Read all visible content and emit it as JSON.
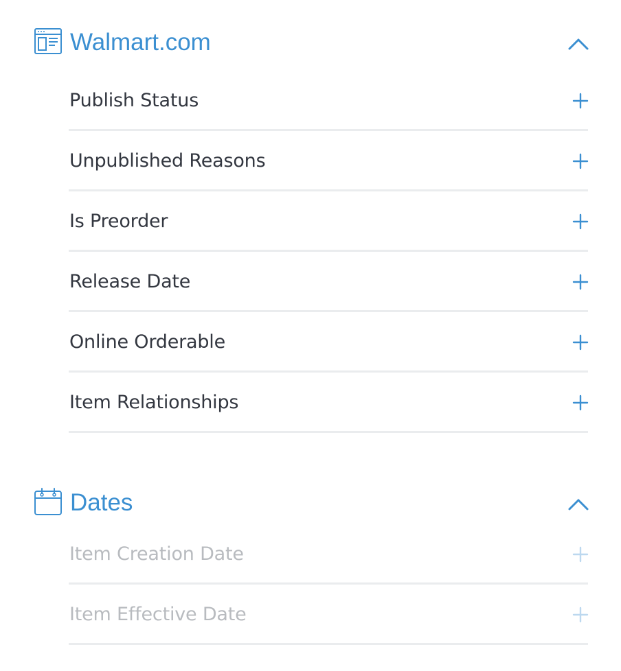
{
  "colors": {
    "accent": "#3b8fd1",
    "text": "#333740",
    "disabled_text": "#b8bbbf",
    "disabled_accent": "#bcd8ef",
    "divider": "#eaecee"
  },
  "sections": [
    {
      "title": "Walmart.com",
      "icon": "browser-window-icon",
      "toggle_icon": "chevron-up-icon",
      "items": [
        {
          "label": "Publish Status",
          "action_icon": "plus-icon"
        },
        {
          "label": "Unpublished Reasons",
          "action_icon": "plus-icon"
        },
        {
          "label": "Is Preorder",
          "action_icon": "plus-icon"
        },
        {
          "label": "Release Date",
          "action_icon": "plus-icon"
        },
        {
          "label": "Online Orderable",
          "action_icon": "plus-icon"
        },
        {
          "label": "Item Relationships",
          "action_icon": "plus-icon"
        }
      ]
    },
    {
      "title": "Dates",
      "icon": "calendar-icon",
      "toggle_icon": "chevron-up-icon",
      "items": [
        {
          "label": "Item Creation Date",
          "action_icon": "plus-icon",
          "disabled": true
        },
        {
          "label": "Item Effective Date",
          "action_icon": "plus-icon",
          "disabled": true
        }
      ]
    }
  ]
}
